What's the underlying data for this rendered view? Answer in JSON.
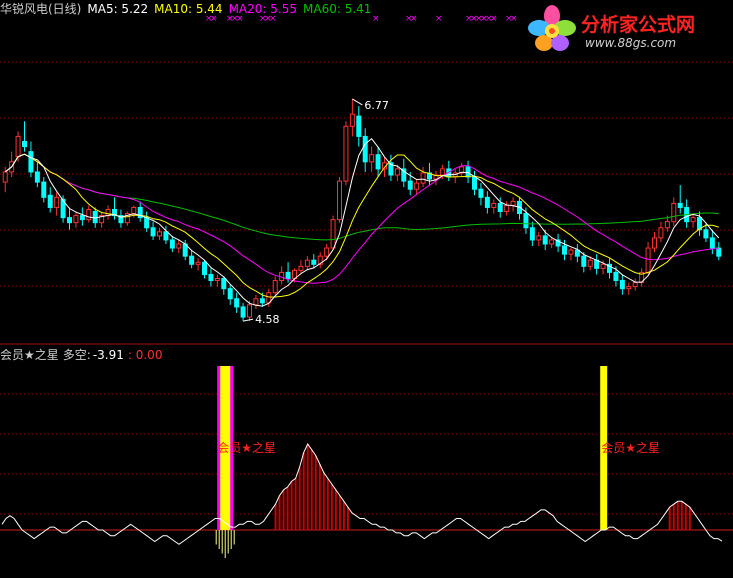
{
  "window": {
    "stock_title": "华锐风电(日线)"
  },
  "header": {
    "ma5_label": "MA5: 5.22",
    "ma10_label": "MA10: 5.44",
    "ma20_label": "MA20: 5.55",
    "ma60_label": "MA60: 5.41"
  },
  "indicator": {
    "name": "会员★之星",
    "value_label": "多空:",
    "value": "-3.91",
    "value2": ": 0.00",
    "signal_label": "会员★之星"
  },
  "watermark": {
    "title": "分析家公式网",
    "url": "www.88gs.com"
  },
  "colors": {
    "background": "#000000",
    "up": "#ff3030",
    "down": "#00ffff",
    "ma5": "#ffffff",
    "ma10": "#ffff00",
    "ma20": "#ff00ff",
    "ma60": "#00c000",
    "signal_bar": "#ffff00",
    "signal_outline": "#ff00ff",
    "grid": "#8b0000"
  },
  "chart_data": [
    {
      "type": "candlestick",
      "title": "华锐风电(日线)",
      "annotations": [
        {
          "text": "6.77",
          "kind": "period_high"
        },
        {
          "text": "4.58",
          "kind": "period_low"
        }
      ],
      "series": [
        {
          "name": "MA5",
          "last": 5.22
        },
        {
          "name": "MA10",
          "last": 5.44
        },
        {
          "name": "MA20",
          "last": 5.55
        },
        {
          "name": "MA60",
          "last": 5.41
        }
      ],
      "candles": [
        [
          5.95,
          6.1,
          6.05,
          5.85
        ],
        [
          6.05,
          6.25,
          6.15,
          6.0
        ],
        [
          6.2,
          6.45,
          6.4,
          6.15
        ],
        [
          6.35,
          6.55,
          6.3,
          6.25
        ],
        [
          6.25,
          6.35,
          6.05,
          6.0
        ],
        [
          6.05,
          6.15,
          5.95,
          5.9
        ],
        [
          5.95,
          6.0,
          5.8,
          5.75
        ],
        [
          5.82,
          5.9,
          5.7,
          5.65
        ],
        [
          5.7,
          5.85,
          5.8,
          5.62
        ],
        [
          5.78,
          5.82,
          5.6,
          5.55
        ],
        [
          5.6,
          5.7,
          5.55,
          5.48
        ],
        [
          5.55,
          5.65,
          5.62,
          5.5
        ],
        [
          5.62,
          5.7,
          5.58,
          5.52
        ],
        [
          5.58,
          5.72,
          5.68,
          5.55
        ],
        [
          5.66,
          5.7,
          5.55,
          5.5
        ],
        [
          5.55,
          5.65,
          5.62,
          5.5
        ],
        [
          5.62,
          5.72,
          5.68,
          5.58
        ],
        [
          5.68,
          5.8,
          5.62,
          5.58
        ],
        [
          5.62,
          5.68,
          5.55,
          5.5
        ],
        [
          5.55,
          5.66,
          5.64,
          5.52
        ],
        [
          5.64,
          5.72,
          5.7,
          5.6
        ],
        [
          5.7,
          5.76,
          5.6,
          5.56
        ],
        [
          5.6,
          5.66,
          5.5,
          5.46
        ],
        [
          5.5,
          5.56,
          5.42,
          5.38
        ],
        [
          5.42,
          5.5,
          5.46,
          5.38
        ],
        [
          5.46,
          5.52,
          5.38,
          5.34
        ],
        [
          5.38,
          5.42,
          5.3,
          5.26
        ],
        [
          5.3,
          5.38,
          5.34,
          5.25
        ],
        [
          5.34,
          5.38,
          5.22,
          5.18
        ],
        [
          5.22,
          5.28,
          5.14,
          5.1
        ],
        [
          5.14,
          5.2,
          5.16,
          5.08
        ],
        [
          5.16,
          5.18,
          5.04,
          5.0
        ],
        [
          5.04,
          5.1,
          4.98,
          4.92
        ],
        [
          4.98,
          5.04,
          5.0,
          4.92
        ],
        [
          5.0,
          5.02,
          4.9,
          4.84
        ],
        [
          4.9,
          4.94,
          4.8,
          4.74
        ],
        [
          4.8,
          4.86,
          4.72,
          4.66
        ],
        [
          4.72,
          4.76,
          4.62,
          4.58
        ],
        [
          4.62,
          4.78,
          4.74,
          4.58
        ],
        [
          4.74,
          4.84,
          4.8,
          4.7
        ],
        [
          4.8,
          4.86,
          4.76,
          4.72
        ],
        [
          4.76,
          4.9,
          4.86,
          4.72
        ],
        [
          4.86,
          5.02,
          4.98,
          4.84
        ],
        [
          4.98,
          5.12,
          5.06,
          4.94
        ],
        [
          5.06,
          5.16,
          5.0,
          4.96
        ],
        [
          5.0,
          5.1,
          5.08,
          4.96
        ],
        [
          5.08,
          5.18,
          5.12,
          5.04
        ],
        [
          5.12,
          5.22,
          5.18,
          5.08
        ],
        [
          5.18,
          5.24,
          5.14,
          5.1
        ],
        [
          5.14,
          5.26,
          5.22,
          5.1
        ],
        [
          5.22,
          5.34,
          5.3,
          5.18
        ],
        [
          5.3,
          5.62,
          5.58,
          5.28
        ],
        [
          5.58,
          6.0,
          5.96,
          5.55
        ],
        [
          5.96,
          6.55,
          6.5,
          5.92
        ],
        [
          6.5,
          6.77,
          6.62,
          6.4
        ],
        [
          6.6,
          6.7,
          6.4,
          6.3
        ],
        [
          6.4,
          6.48,
          6.15,
          6.05
        ],
        [
          6.15,
          6.3,
          6.22,
          6.05
        ],
        [
          6.22,
          6.3,
          6.08,
          6.0
        ],
        [
          6.08,
          6.2,
          6.14,
          6.0
        ],
        [
          6.14,
          6.22,
          6.02,
          5.96
        ],
        [
          6.02,
          6.12,
          6.08,
          5.96
        ],
        [
          6.08,
          6.18,
          5.96,
          5.9
        ],
        [
          5.96,
          6.05,
          5.88,
          5.82
        ],
        [
          5.88,
          5.98,
          5.94,
          5.82
        ],
        [
          5.94,
          6.1,
          6.04,
          5.9
        ],
        [
          6.04,
          6.14,
          5.98,
          5.92
        ],
        [
          5.98,
          6.06,
          6.02,
          5.92
        ],
        [
          6.02,
          6.12,
          6.08,
          5.98
        ],
        [
          6.08,
          6.16,
          6.0,
          5.96
        ],
        [
          6.0,
          6.08,
          6.04,
          5.94
        ],
        [
          6.04,
          6.14,
          6.1,
          6.0
        ],
        [
          6.1,
          6.16,
          6.0,
          5.94
        ],
        [
          6.0,
          6.06,
          5.88,
          5.82
        ],
        [
          5.88,
          5.94,
          5.8,
          5.72
        ],
        [
          5.8,
          5.86,
          5.7,
          5.64
        ],
        [
          5.7,
          5.78,
          5.74,
          5.64
        ],
        [
          5.74,
          5.8,
          5.66,
          5.6
        ],
        [
          5.66,
          5.76,
          5.72,
          5.62
        ],
        [
          5.72,
          5.8,
          5.76,
          5.66
        ],
        [
          5.76,
          5.8,
          5.64,
          5.58
        ],
        [
          5.64,
          5.7,
          5.5,
          5.44
        ],
        [
          5.5,
          5.56,
          5.38,
          5.32
        ],
        [
          5.38,
          5.46,
          5.42,
          5.32
        ],
        [
          5.42,
          5.48,
          5.34,
          5.28
        ],
        [
          5.34,
          5.4,
          5.38,
          5.3
        ],
        [
          5.38,
          5.44,
          5.32,
          5.26
        ],
        [
          5.32,
          5.38,
          5.24,
          5.18
        ],
        [
          5.24,
          5.3,
          5.28,
          5.18
        ],
        [
          5.28,
          5.34,
          5.22,
          5.16
        ],
        [
          5.22,
          5.26,
          5.12,
          5.06
        ],
        [
          5.12,
          5.22,
          5.18,
          5.08
        ],
        [
          5.18,
          5.24,
          5.1,
          5.04
        ],
        [
          5.1,
          5.18,
          5.14,
          5.04
        ],
        [
          5.14,
          5.2,
          5.06,
          5.0
        ],
        [
          5.06,
          5.12,
          4.98,
          4.92
        ],
        [
          4.98,
          5.04,
          4.9,
          4.84
        ],
        [
          4.9,
          4.96,
          4.92,
          4.84
        ],
        [
          4.92,
          5.0,
          4.96,
          4.88
        ],
        [
          4.96,
          5.1,
          5.06,
          4.92
        ],
        [
          5.06,
          5.36,
          5.3,
          5.04
        ],
        [
          5.3,
          5.46,
          5.4,
          5.26
        ],
        [
          5.4,
          5.56,
          5.5,
          5.36
        ],
        [
          5.5,
          5.62,
          5.56,
          5.46
        ],
        [
          5.56,
          5.8,
          5.74,
          5.52
        ],
        [
          5.74,
          5.92,
          5.7,
          5.64
        ],
        [
          5.7,
          5.78,
          5.56,
          5.5
        ],
        [
          5.56,
          5.64,
          5.6,
          5.5
        ],
        [
          5.6,
          5.66,
          5.48,
          5.42
        ],
        [
          5.48,
          5.54,
          5.4,
          5.36
        ],
        [
          5.4,
          5.48,
          5.3,
          5.24
        ],
        [
          5.3,
          5.36,
          5.22,
          5.18
        ]
      ]
    },
    {
      "type": "area",
      "title": "会员★之星",
      "series": [
        {
          "name": "多空",
          "last": -3.91
        }
      ],
      "values": [
        2,
        4,
        5,
        4,
        2,
        0,
        -1,
        -2,
        -3,
        -2,
        -1,
        0,
        1,
        1,
        0,
        -1,
        -1,
        0,
        1,
        2,
        3,
        3,
        2,
        1,
        0,
        0,
        -1,
        -2,
        -2,
        -1,
        0,
        1,
        2,
        1,
        0,
        -1,
        -2,
        -3,
        -4,
        -3,
        -2,
        -2,
        -3,
        -4,
        -5,
        -4,
        -3,
        -2,
        -1,
        0,
        1,
        2,
        3,
        4,
        4,
        3,
        2,
        1,
        1,
        2,
        2,
        3,
        3,
        2,
        2,
        3,
        5,
        7,
        9,
        12,
        14,
        15,
        17,
        18,
        22,
        27,
        30,
        28,
        26,
        23,
        20,
        18,
        16,
        14,
        12,
        10,
        8,
        6,
        5,
        4,
        4,
        3,
        2,
        2,
        1,
        1,
        0,
        0,
        -1,
        -1,
        -2,
        -2,
        -1,
        -1,
        -2,
        -3,
        -2,
        -1,
        -1,
        0,
        1,
        2,
        3,
        4,
        4,
        3,
        2,
        1,
        0,
        -1,
        -2,
        -3,
        -2,
        -1,
        0,
        1,
        1,
        2,
        2,
        3,
        3,
        4,
        5,
        6,
        7,
        7,
        6,
        5,
        3,
        2,
        1,
        0,
        -1,
        -2,
        -3,
        -4,
        -3,
        -2,
        -1,
        0,
        0,
        1,
        1,
        0,
        -1,
        -2,
        -2,
        -3,
        -3,
        -2,
        -1,
        0,
        1,
        2,
        4,
        6,
        8,
        9,
        10,
        10,
        9,
        8,
        6,
        4,
        2,
        0,
        -2,
        -3,
        -3,
        -3.91
      ],
      "signals": [
        {
          "position": 0.31,
          "label": "会员★之星"
        },
        {
          "position": 0.835,
          "label": "会员★之星"
        }
      ]
    }
  ]
}
